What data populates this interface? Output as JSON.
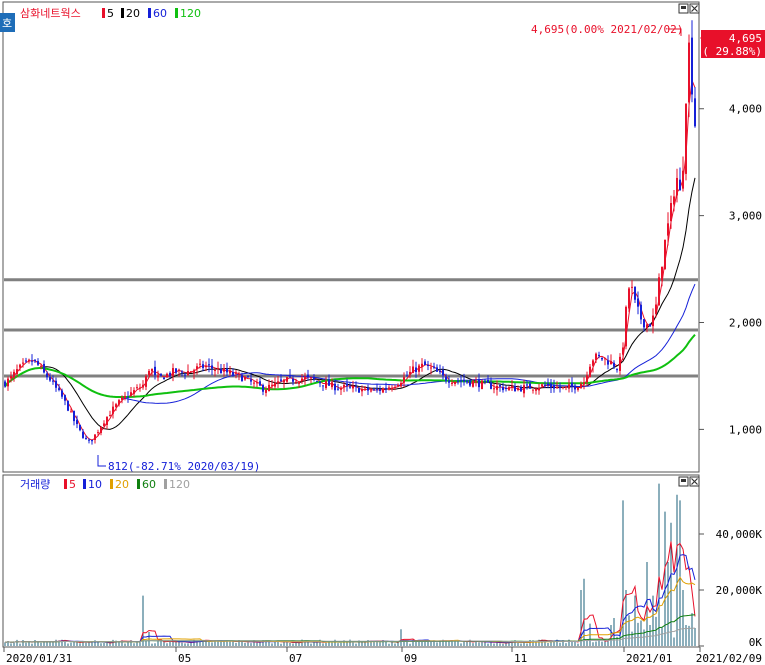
{
  "window": {
    "corner_label": "호",
    "panel_buttons": [
      "minimize-icon",
      "close-icon"
    ]
  },
  "price_legend": {
    "name": "삼화네트웍스",
    "items": [
      {
        "label": "5",
        "color": "#e8102a"
      },
      {
        "label": "20",
        "color": "#000000"
      },
      {
        "label": "60",
        "color": "#1520d8"
      },
      {
        "label": "120",
        "color": "#10c010"
      }
    ]
  },
  "volume_legend": {
    "name": "거래량",
    "items": [
      {
        "label": "5",
        "color": "#e8102a"
      },
      {
        "label": "10",
        "color": "#1520d8"
      },
      {
        "label": "20",
        "color": "#e0a000"
      },
      {
        "label": "60",
        "color": "#108010"
      },
      {
        "label": "120",
        "color": "#a0a0a0"
      }
    ]
  },
  "annotations": {
    "high": "4,695(0.00% 2021/02/02)",
    "low": "812(-82.71% 2020/03/19)",
    "last_price": "4,695",
    "last_change": "( 29.88%)"
  },
  "x_axis": {
    "labels": [
      "2020/01/31",
      "05",
      "07",
      "09",
      "11",
      "2021/01",
      "2021/02/09"
    ]
  },
  "chart_data": [
    {
      "type": "candlestick",
      "title": "삼화네트웍스",
      "series": [
        {
          "name": "5",
          "color": "#e8102a"
        },
        {
          "name": "20",
          "color": "#000000"
        },
        {
          "name": "60",
          "color": "#1520d8"
        },
        {
          "name": "120",
          "color": "#10c010"
        }
      ],
      "y_ticks": [
        {
          "value": 1000,
          "label": "1,000"
        },
        {
          "value": 2000,
          "label": "2,000"
        },
        {
          "value": 3000,
          "label": "3,000"
        },
        {
          "value": 4000,
          "label": "4,000"
        }
      ],
      "ylim": [
        620,
        4980
      ],
      "support_lines": [
        1500,
        1930,
        2400
      ],
      "x_labels": [
        "2020/01/31",
        "05",
        "07",
        "09",
        "11",
        "2021/01",
        "2021/02/09"
      ],
      "close_path": [
        [
          0,
          1430
        ],
        [
          7,
          1480
        ],
        [
          14,
          1560
        ],
        [
          22,
          1610
        ],
        [
          28,
          1640
        ],
        [
          34,
          1600
        ],
        [
          40,
          1520
        ],
        [
          46,
          1470
        ],
        [
          52,
          1380
        ],
        [
          58,
          1300
        ],
        [
          64,
          1200
        ],
        [
          70,
          1080
        ],
        [
          76,
          980
        ],
        [
          82,
          900
        ],
        [
          86,
          880
        ],
        [
          92,
          960
        ],
        [
          100,
          1080
        ],
        [
          108,
          1180
        ],
        [
          116,
          1260
        ],
        [
          124,
          1320
        ],
        [
          132,
          1370
        ],
        [
          140,
          1420
        ],
        [
          146,
          1600
        ],
        [
          152,
          1460
        ],
        [
          160,
          1500
        ],
        [
          170,
          1540
        ],
        [
          180,
          1530
        ],
        [
          190,
          1560
        ],
        [
          200,
          1590
        ],
        [
          210,
          1570
        ],
        [
          220,
          1540
        ],
        [
          230,
          1510
        ],
        [
          240,
          1480
        ],
        [
          250,
          1420
        ],
        [
          260,
          1380
        ],
        [
          270,
          1410
        ],
        [
          280,
          1450
        ],
        [
          290,
          1470
        ],
        [
          300,
          1480
        ],
        [
          310,
          1460
        ],
        [
          320,
          1430
        ],
        [
          330,
          1400
        ],
        [
          340,
          1390
        ],
        [
          350,
          1380
        ],
        [
          360,
          1370
        ],
        [
          370,
          1360
        ],
        [
          380,
          1380
        ],
        [
          390,
          1420
        ],
        [
          400,
          1480
        ],
        [
          410,
          1560
        ],
        [
          420,
          1600
        ],
        [
          430,
          1550
        ],
        [
          440,
          1480
        ],
        [
          450,
          1460
        ],
        [
          460,
          1450
        ],
        [
          470,
          1440
        ],
        [
          480,
          1420
        ],
        [
          490,
          1400
        ],
        [
          500,
          1390
        ],
        [
          510,
          1380
        ],
        [
          520,
          1390
        ],
        [
          530,
          1400
        ],
        [
          540,
          1410
        ],
        [
          550,
          1400
        ],
        [
          560,
          1380
        ],
        [
          570,
          1400
        ],
        [
          580,
          1450
        ],
        [
          585,
          1600
        ],
        [
          590,
          1680
        ],
        [
          600,
          1660
        ],
        [
          608,
          1620
        ],
        [
          614,
          1580
        ],
        [
          618,
          1700
        ],
        [
          622,
          2100
        ],
        [
          626,
          2400
        ],
        [
          630,
          2200
        ],
        [
          636,
          2050
        ],
        [
          642,
          1980
        ],
        [
          648,
          2000
        ],
        [
          652,
          2150
        ],
        [
          656,
          2450
        ],
        [
          660,
          2700
        ],
        [
          664,
          2900
        ],
        [
          668,
          3100
        ],
        [
          672,
          3400
        ],
        [
          676,
          3200
        ],
        [
          680,
          3600
        ],
        [
          684,
          4695
        ],
        [
          690,
          4000
        ],
        [
          696,
          3200
        ],
        [
          700,
          4695
        ]
      ]
    },
    {
      "type": "bar",
      "title": "거래량",
      "y_ticks": [
        {
          "value": 0,
          "label": "0K"
        },
        {
          "value": 20000,
          "label": "20,000K"
        },
        {
          "value": 40000,
          "label": "40,000K"
        }
      ],
      "ylim": [
        0,
        60000
      ],
      "series": [
        {
          "name": "5",
          "color": "#e8102a"
        },
        {
          "name": "10",
          "color": "#1520d8"
        },
        {
          "name": "20",
          "color": "#e0a000"
        },
        {
          "name": "60",
          "color": "#108010"
        },
        {
          "name": "120",
          "color": "#a0a0a0"
        }
      ],
      "spikes": [
        [
          143,
          18000
        ],
        [
          148,
          5000
        ],
        [
          400,
          6000
        ],
        [
          580,
          20000
        ],
        [
          584,
          24000
        ],
        [
          590,
          8000
        ],
        [
          614,
          10000
        ],
        [
          622,
          52000
        ],
        [
          626,
          20000
        ],
        [
          636,
          18000
        ],
        [
          646,
          30000
        ],
        [
          652,
          18000
        ],
        [
          658,
          58000
        ],
        [
          664,
          48000
        ],
        [
          668,
          30000
        ],
        [
          672,
          44000
        ],
        [
          676,
          54000
        ],
        [
          680,
          52000
        ],
        [
          684,
          20000
        ]
      ]
    }
  ]
}
